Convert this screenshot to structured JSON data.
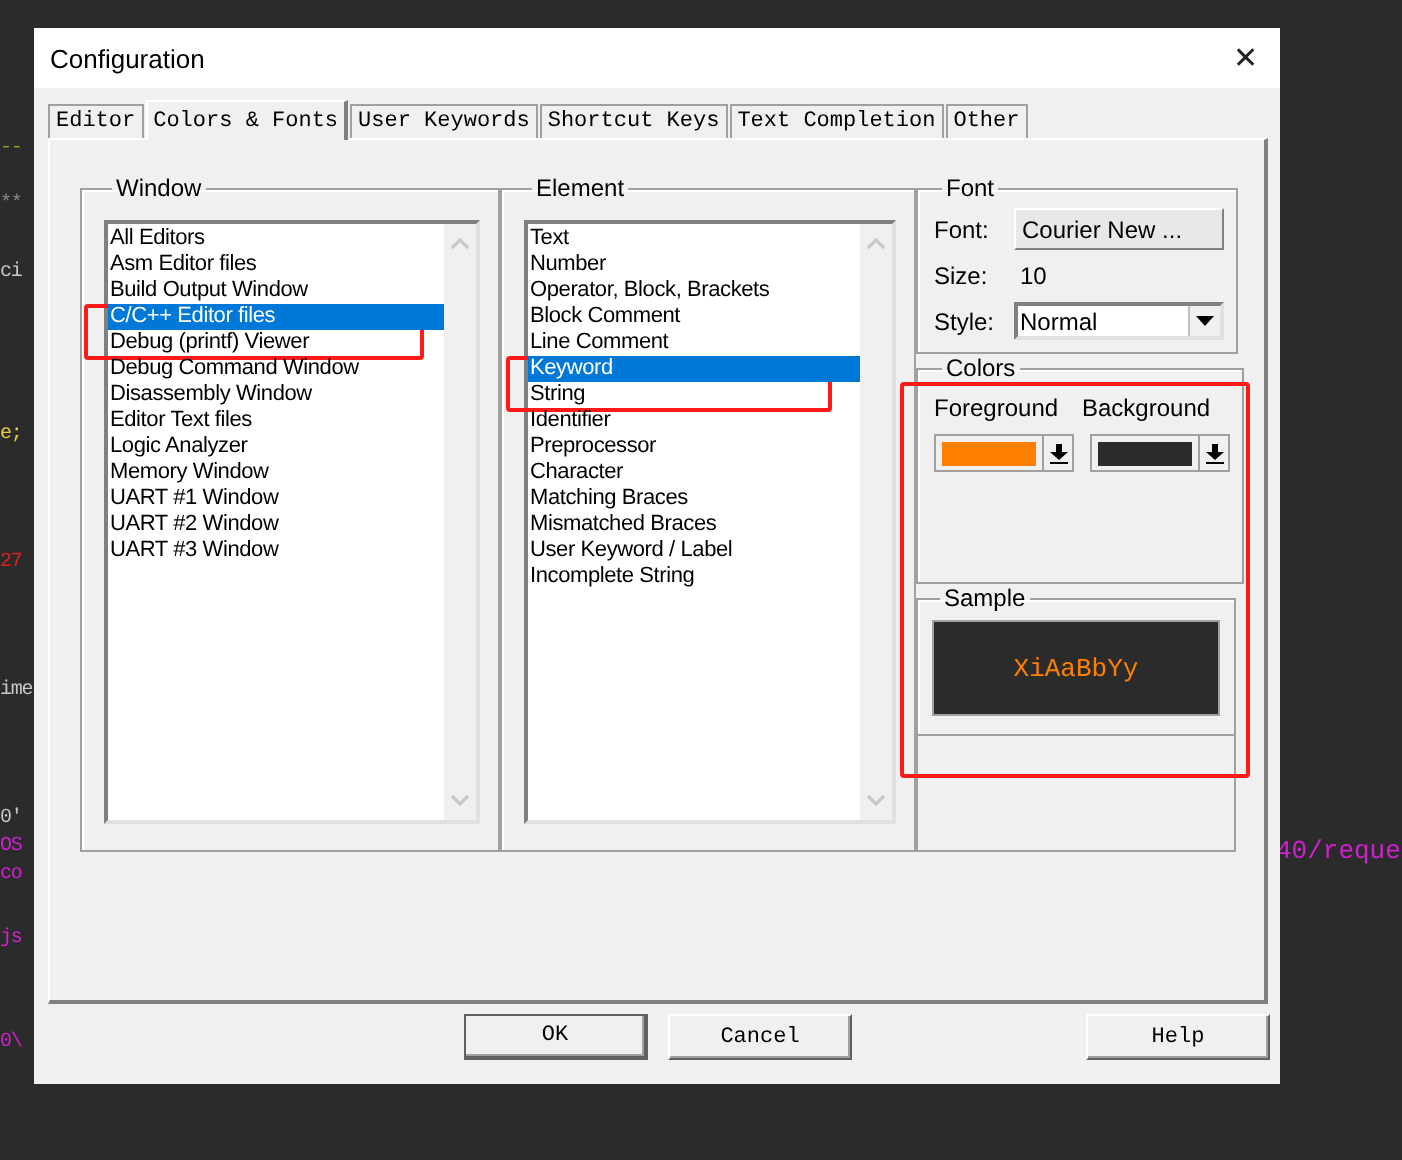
{
  "editor_fragments_left": [
    {
      "text": "--",
      "color": "#9a9a20"
    },
    {
      "text": "**",
      "color": "#8a8a8a"
    },
    {
      "text": "ci",
      "color": "#c8c8c8"
    },
    {
      "text": "e;",
      "color": "#e8d040"
    },
    {
      "text": "27",
      "color": "#e02020"
    },
    {
      "text": "ime",
      "color": "#c8c8c8"
    },
    {
      "text": "0'",
      "color": "#c8c8c8"
    },
    {
      "text": "OS",
      "color": "#d020d0"
    },
    {
      "text": "co",
      "color": "#d020d0"
    },
    {
      "text": "js",
      "color": "#d020d0"
    },
    {
      "text": "0\\",
      "color": "#d020d0"
    }
  ],
  "editor_fragments_right": [
    {
      "text": "40/reque",
      "color": "#d020d0"
    }
  ],
  "window": {
    "title": "Configuration",
    "close": "✕"
  },
  "tabs": [
    {
      "label": "Editor",
      "selected": false
    },
    {
      "label": "Colors & Fonts",
      "selected": true
    },
    {
      "label": "User Keywords",
      "selected": false
    },
    {
      "label": "Shortcut Keys",
      "selected": false
    },
    {
      "label": "Text Completion",
      "selected": false
    },
    {
      "label": "Other",
      "selected": false
    }
  ],
  "window_group": {
    "title": "Window",
    "items": [
      {
        "label": "All Editors",
        "selected": false
      },
      {
        "label": "Asm Editor files",
        "selected": false
      },
      {
        "label": "Build Output Window",
        "selected": false
      },
      {
        "label": "C/C++ Editor files",
        "selected": true
      },
      {
        "label": "Debug (printf) Viewer",
        "selected": false
      },
      {
        "label": "Debug Command Window",
        "selected": false
      },
      {
        "label": "Disassembly Window",
        "selected": false
      },
      {
        "label": "Editor Text files",
        "selected": false
      },
      {
        "label": "Logic Analyzer",
        "selected": false
      },
      {
        "label": "Memory Window",
        "selected": false
      },
      {
        "label": "UART #1 Window",
        "selected": false
      },
      {
        "label": "UART #2 Window",
        "selected": false
      },
      {
        "label": "UART #3 Window",
        "selected": false
      }
    ]
  },
  "element_group": {
    "title": "Element",
    "items": [
      {
        "label": "Text",
        "selected": false
      },
      {
        "label": "Number",
        "selected": false
      },
      {
        "label": "Operator, Block, Brackets",
        "selected": false
      },
      {
        "label": "Block Comment",
        "selected": false
      },
      {
        "label": "Line Comment",
        "selected": false
      },
      {
        "label": "Keyword",
        "selected": true
      },
      {
        "label": "String",
        "selected": false
      },
      {
        "label": "Identifier",
        "selected": false
      },
      {
        "label": "Preprocessor",
        "selected": false
      },
      {
        "label": "Character",
        "selected": false
      },
      {
        "label": "Matching Braces",
        "selected": false
      },
      {
        "label": "Mismatched Braces",
        "selected": false
      },
      {
        "label": "User Keyword / Label",
        "selected": false
      },
      {
        "label": "Incomplete String",
        "selected": false
      }
    ]
  },
  "font_group": {
    "title": "Font",
    "font_label": "Font:",
    "font_button": "Courier New ...",
    "size_label": "Size:",
    "size": "10",
    "style_label": "Style:",
    "style": "Normal"
  },
  "colors_group": {
    "title": "Colors",
    "swatches": [
      {
        "label": "Foreground",
        "color": "#ff8000"
      },
      {
        "label": "Background",
        "color": "#2b2b2b"
      }
    ]
  },
  "sample_group": {
    "title": "Sample",
    "text": "XiAaBbYy"
  },
  "buttons": [
    "OK",
    "Cancel",
    "Help"
  ],
  "annotation_boxes": [
    {
      "kind": "window_selection"
    },
    {
      "kind": "element_selection"
    },
    {
      "kind": "colors"
    }
  ]
}
